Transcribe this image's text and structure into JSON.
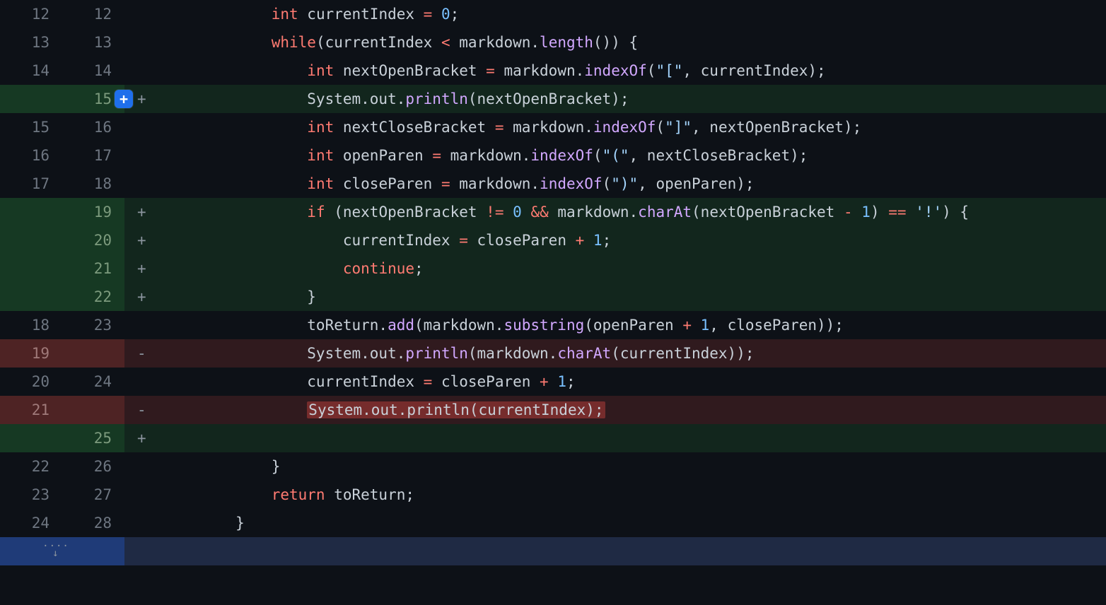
{
  "lines": [
    {
      "old": "12",
      "new": "12",
      "type": "ctx",
      "marker": "",
      "tokens": [
        [
          "pl",
          "            "
        ],
        [
          "kw",
          "int"
        ],
        [
          "pl",
          " currentIndex "
        ],
        [
          "op",
          "="
        ],
        [
          "pl",
          " "
        ],
        [
          "num",
          "0"
        ],
        [
          "pl",
          ";"
        ]
      ]
    },
    {
      "old": "13",
      "new": "13",
      "type": "ctx",
      "marker": "",
      "tokens": [
        [
          "pl",
          "            "
        ],
        [
          "kw",
          "while"
        ],
        [
          "pl",
          "(currentIndex "
        ],
        [
          "op",
          "<"
        ],
        [
          "pl",
          " markdown."
        ],
        [
          "fn",
          "length"
        ],
        [
          "pl",
          "()) {"
        ]
      ]
    },
    {
      "old": "14",
      "new": "14",
      "type": "ctx",
      "marker": "",
      "tokens": [
        [
          "pl",
          "                "
        ],
        [
          "kw",
          "int"
        ],
        [
          "pl",
          " nextOpenBracket "
        ],
        [
          "op",
          "="
        ],
        [
          "pl",
          " markdown."
        ],
        [
          "fn",
          "indexOf"
        ],
        [
          "pl",
          "("
        ],
        [
          "str",
          "\"[\""
        ],
        [
          "pl",
          ", currentIndex);"
        ]
      ]
    },
    {
      "old": "",
      "new": "15",
      "type": "add",
      "marker": "+",
      "badge": true,
      "tokens": [
        [
          "pl",
          "                System.out."
        ],
        [
          "fn",
          "println"
        ],
        [
          "pl",
          "(nextOpenBracket);"
        ]
      ]
    },
    {
      "old": "15",
      "new": "16",
      "type": "ctx",
      "marker": "",
      "tokens": [
        [
          "pl",
          "                "
        ],
        [
          "kw",
          "int"
        ],
        [
          "pl",
          " nextCloseBracket "
        ],
        [
          "op",
          "="
        ],
        [
          "pl",
          " markdown."
        ],
        [
          "fn",
          "indexOf"
        ],
        [
          "pl",
          "("
        ],
        [
          "str",
          "\"]\""
        ],
        [
          "pl",
          ", nextOpenBracket);"
        ]
      ]
    },
    {
      "old": "16",
      "new": "17",
      "type": "ctx",
      "marker": "",
      "tokens": [
        [
          "pl",
          "                "
        ],
        [
          "kw",
          "int"
        ],
        [
          "pl",
          " openParen "
        ],
        [
          "op",
          "="
        ],
        [
          "pl",
          " markdown."
        ],
        [
          "fn",
          "indexOf"
        ],
        [
          "pl",
          "("
        ],
        [
          "str",
          "\"(\""
        ],
        [
          "pl",
          ", nextCloseBracket);"
        ]
      ]
    },
    {
      "old": "17",
      "new": "18",
      "type": "ctx",
      "marker": "",
      "tokens": [
        [
          "pl",
          "                "
        ],
        [
          "kw",
          "int"
        ],
        [
          "pl",
          " closeParen "
        ],
        [
          "op",
          "="
        ],
        [
          "pl",
          " markdown."
        ],
        [
          "fn",
          "indexOf"
        ],
        [
          "pl",
          "("
        ],
        [
          "str",
          "\")\""
        ],
        [
          "pl",
          ", openParen);"
        ]
      ]
    },
    {
      "old": "",
      "new": "19",
      "type": "add",
      "marker": "+",
      "tokens": [
        [
          "pl",
          "                "
        ],
        [
          "kw",
          "if"
        ],
        [
          "pl",
          " (nextOpenBracket "
        ],
        [
          "op",
          "!="
        ],
        [
          "pl",
          " "
        ],
        [
          "num",
          "0"
        ],
        [
          "pl",
          " "
        ],
        [
          "op",
          "&&"
        ],
        [
          "pl",
          " markdown."
        ],
        [
          "fn",
          "charAt"
        ],
        [
          "pl",
          "(nextOpenBracket "
        ],
        [
          "op",
          "-"
        ],
        [
          "pl",
          " "
        ],
        [
          "num",
          "1"
        ],
        [
          "pl",
          ") "
        ],
        [
          "op",
          "=="
        ],
        [
          "pl",
          " "
        ],
        [
          "str",
          "'!'"
        ],
        [
          "pl",
          ") {"
        ]
      ]
    },
    {
      "old": "",
      "new": "20",
      "type": "add",
      "marker": "+",
      "tokens": [
        [
          "pl",
          "                    currentIndex "
        ],
        [
          "op",
          "="
        ],
        [
          "pl",
          " closeParen "
        ],
        [
          "op",
          "+"
        ],
        [
          "pl",
          " "
        ],
        [
          "num",
          "1"
        ],
        [
          "pl",
          ";"
        ]
      ]
    },
    {
      "old": "",
      "new": "21",
      "type": "add",
      "marker": "+",
      "tokens": [
        [
          "pl",
          "                    "
        ],
        [
          "kw",
          "continue"
        ],
        [
          "pl",
          ";"
        ]
      ]
    },
    {
      "old": "",
      "new": "22",
      "type": "add",
      "marker": "+",
      "tokens": [
        [
          "pl",
          "                }"
        ]
      ]
    },
    {
      "old": "18",
      "new": "23",
      "type": "ctx",
      "marker": "",
      "tokens": [
        [
          "pl",
          "                toReturn."
        ],
        [
          "fn",
          "add"
        ],
        [
          "pl",
          "(markdown."
        ],
        [
          "fn",
          "substring"
        ],
        [
          "pl",
          "(openParen "
        ],
        [
          "op",
          "+"
        ],
        [
          "pl",
          " "
        ],
        [
          "num",
          "1"
        ],
        [
          "pl",
          ", closeParen));"
        ]
      ]
    },
    {
      "old": "19",
      "new": "",
      "type": "del",
      "marker": "-",
      "tokens": [
        [
          "pl",
          "                System.out."
        ],
        [
          "fn",
          "println"
        ],
        [
          "pl",
          "(markdown."
        ],
        [
          "fn",
          "charAt"
        ],
        [
          "pl",
          "(currentIndex));"
        ]
      ]
    },
    {
      "old": "20",
      "new": "24",
      "type": "ctx",
      "marker": "",
      "tokens": [
        [
          "pl",
          "                currentIndex "
        ],
        [
          "op",
          "="
        ],
        [
          "pl",
          " closeParen "
        ],
        [
          "op",
          "+"
        ],
        [
          "pl",
          " "
        ],
        [
          "num",
          "1"
        ],
        [
          "pl",
          ";"
        ]
      ]
    },
    {
      "old": "21",
      "new": "",
      "type": "del",
      "marker": "-",
      "tokens": [
        [
          "pl",
          "                "
        ],
        [
          "hl",
          "System.out.println(currentIndex);"
        ]
      ]
    },
    {
      "old": "",
      "new": "25",
      "type": "add",
      "marker": "+",
      "tokens": [
        [
          "pl",
          ""
        ]
      ]
    },
    {
      "old": "22",
      "new": "26",
      "type": "ctx",
      "marker": "",
      "tokens": [
        [
          "pl",
          "            }"
        ]
      ]
    },
    {
      "old": "23",
      "new": "27",
      "type": "ctx",
      "marker": "",
      "tokens": [
        [
          "pl",
          "            "
        ],
        [
          "kw",
          "return"
        ],
        [
          "pl",
          " toReturn;"
        ]
      ]
    },
    {
      "old": "24",
      "new": "28",
      "type": "ctx",
      "marker": "",
      "tokens": [
        [
          "pl",
          "        }"
        ]
      ]
    }
  ],
  "expand_hint": "····",
  "add_badge_label": "+"
}
